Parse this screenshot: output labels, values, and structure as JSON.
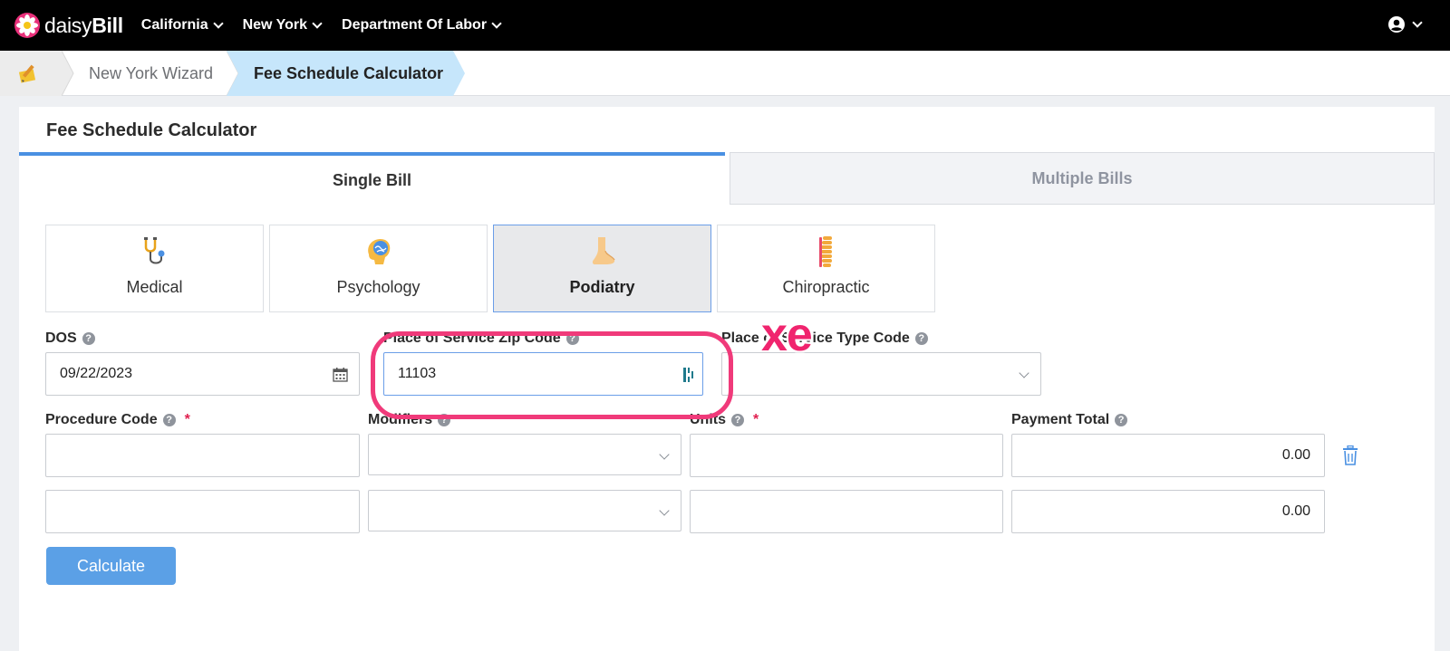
{
  "app": {
    "logo_prefix": "daisy",
    "logo_suffix": "Bill"
  },
  "nav": {
    "items": [
      {
        "label": "California"
      },
      {
        "label": "New York"
      },
      {
        "label": "Department Of Labor"
      }
    ],
    "user_icon": "user-circle-icon"
  },
  "breadcrumb": {
    "home_icon": "pencil-paper-icon",
    "items": [
      {
        "label": "New York Wizard"
      },
      {
        "label": "Fee Schedule Calculator"
      }
    ],
    "active_color": "#c6e6fb"
  },
  "card": {
    "title": "Fee Schedule Calculator"
  },
  "tabs": [
    {
      "label": "Single Bill",
      "active": true
    },
    {
      "label": "Multiple Bills",
      "active": false
    }
  ],
  "specialties": [
    {
      "label": "Medical",
      "icon": "stethoscope-icon",
      "active": false
    },
    {
      "label": "Psychology",
      "icon": "brain-icon",
      "active": false
    },
    {
      "label": "Podiatry",
      "icon": "foot-icon",
      "active": true
    },
    {
      "label": "Chiropractic",
      "icon": "spine-icon",
      "active": false
    }
  ],
  "form": {
    "dos": {
      "label": "DOS",
      "value": "09/22/2023"
    },
    "zip": {
      "label": "Place of Service Zip Code",
      "value": "11103"
    },
    "pos_type": {
      "label": "Place of Service Type Code",
      "value": ""
    },
    "procedure": {
      "label": "Procedure Code",
      "required_mark": "*"
    },
    "modifiers": {
      "label": "Modifiers"
    },
    "units": {
      "label": "Units",
      "required_mark": "*"
    },
    "payment": {
      "label": "Payment Total"
    },
    "rows": [
      {
        "procedure": "",
        "modifier": "",
        "units": "",
        "payment": "0.00"
      },
      {
        "procedure": "",
        "modifier": "",
        "units": "",
        "payment": "0.00"
      }
    ],
    "help_glyph": "?",
    "calculate_label": "Calculate"
  },
  "annotation": {
    "text": "xe",
    "color": "#f0246e"
  }
}
